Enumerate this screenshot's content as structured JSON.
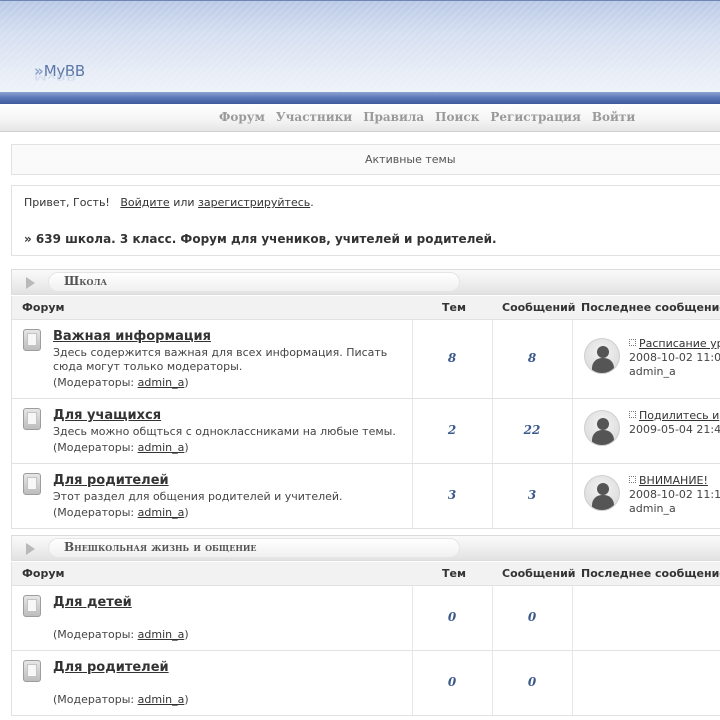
{
  "header": {
    "logo": "MyBB"
  },
  "menu": [
    "Форум",
    "Участники",
    "Правила",
    "Поиск",
    "Регистрация",
    "Войти"
  ],
  "active_topics": "Активные темы",
  "welcome": {
    "greeting": "Привет, Гость!",
    "login": "Войдите",
    "or": "или",
    "register": "зарегистрируйтесь",
    "breadcrumb": "» 639 школа. 3 класс. Форум для учеников, учителей и родителей."
  },
  "columns": {
    "forum": "Форум",
    "topics": "Тем",
    "posts": "Сообщений",
    "last_post": "Последнее сообщение"
  },
  "categories": [
    {
      "title": "Школа",
      "forums": [
        {
          "title": "Важная информация",
          "desc": "Здесь содержится важная для всех информация. Писать сюда могут только модераторы.",
          "mods_label": "(Модераторы: ",
          "mod": "admin_a",
          "mods_end": ")",
          "topics": "8",
          "posts": "8",
          "last": {
            "title": "Расписание ур",
            "date": "2008-10-02 11:0",
            "author": "admin_a"
          }
        },
        {
          "title": "Для учащихся",
          "desc": "Здесь можно общться с одноклассниками на любые темы.",
          "mods_label": "(Модераторы: ",
          "mod": "admin_a",
          "mods_end": ")",
          "topics": "2",
          "posts": "22",
          "last": {
            "title": "Подилитесь и",
            "date": "2009-05-04 21:4",
            "author": ""
          }
        },
        {
          "title": "Для родителей",
          "desc": "Этот раздел для общения родителей и учителей.",
          "mods_label": "(Модераторы: ",
          "mod": "admin_a",
          "mods_end": ")",
          "topics": "3",
          "posts": "3",
          "last": {
            "title": "ВНИМАНИЕ!",
            "date": "2008-10-02 11:1",
            "author": "admin_a"
          }
        }
      ]
    },
    {
      "title": "Внешкольная жизнь и общение",
      "forums": [
        {
          "title": "Для детей",
          "mods_label": "(Модераторы: ",
          "mod": "admin_a",
          "mods_end": ")",
          "topics": "0",
          "posts": "0"
        },
        {
          "title": "Для родителей",
          "mods_label": "(Модераторы: ",
          "mod": "admin_a",
          "mods_end": ")",
          "topics": "0",
          "posts": "0"
        }
      ]
    }
  ]
}
